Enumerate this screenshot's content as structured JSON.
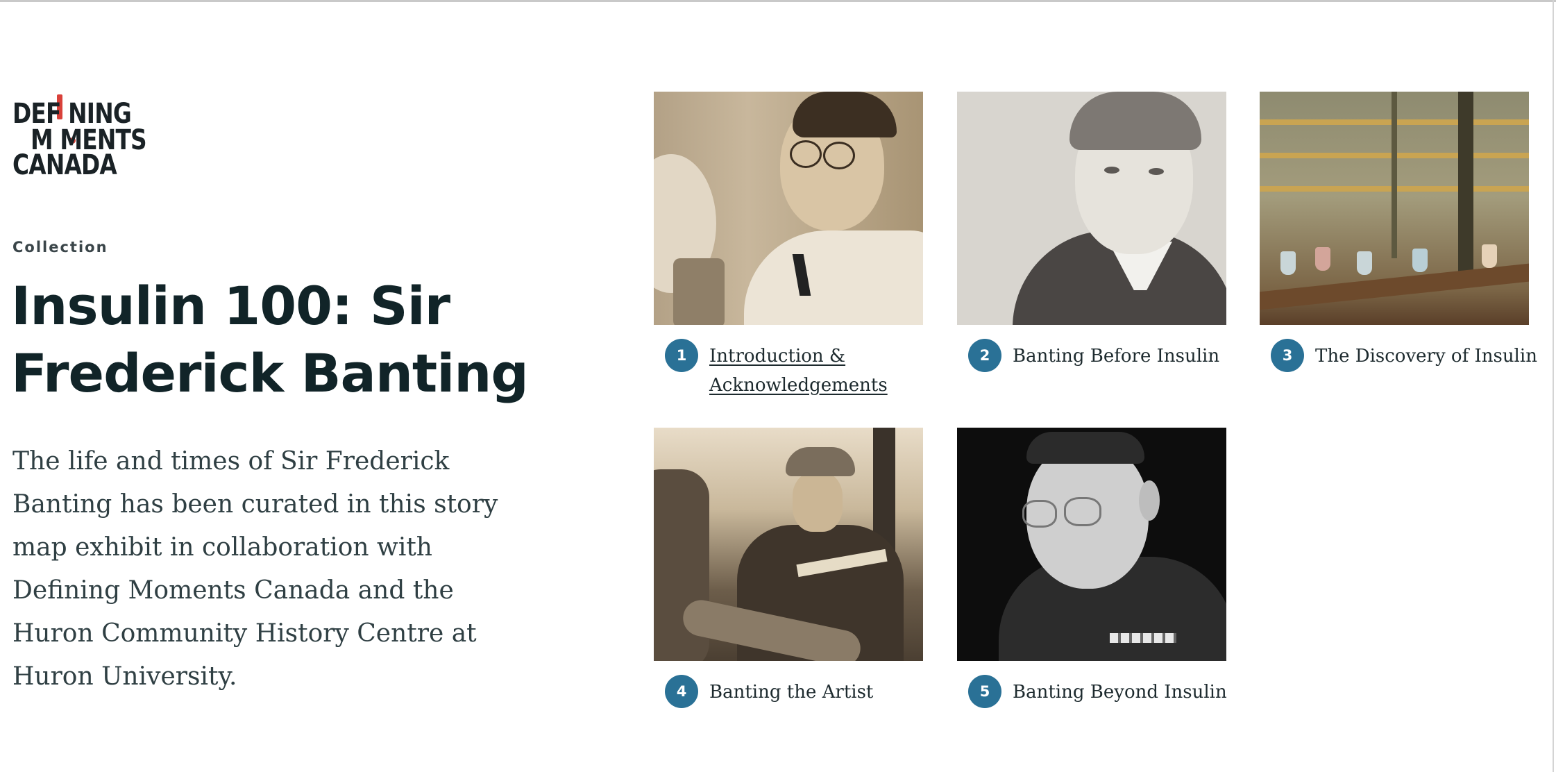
{
  "brand": {
    "logo_line1": "DEF NING",
    "logo_line2": "M MENTS",
    "logo_line3": "CANADA",
    "accent": "#d9413a"
  },
  "header": {
    "eyebrow": "Collection",
    "title": "Insulin 100: Sir Frederick Banting",
    "intro": "The life and times of Sir Frederick Banting has been curated in this story map exhibit in collaboration with Defining Moments Canada and the Huron Community History Centre at Huron University."
  },
  "theme": {
    "badge_color": "#2a7196",
    "title_color": "#112428"
  },
  "stories": [
    {
      "number": "1",
      "label": "Introduction & Acknowledgements",
      "image": "Banting portrait in lab coat"
    },
    {
      "number": "2",
      "label": "Banting Before Insulin",
      "image": "childhood portrait"
    },
    {
      "number": "3",
      "label": "The Discovery of Insulin",
      "image": "painting of a laboratory"
    },
    {
      "number": "4",
      "label": "Banting the Artist",
      "image": "Banting sketching outdoors"
    },
    {
      "number": "5",
      "label": "Banting Beyond Insulin",
      "image": "Banting in military uniform"
    }
  ]
}
